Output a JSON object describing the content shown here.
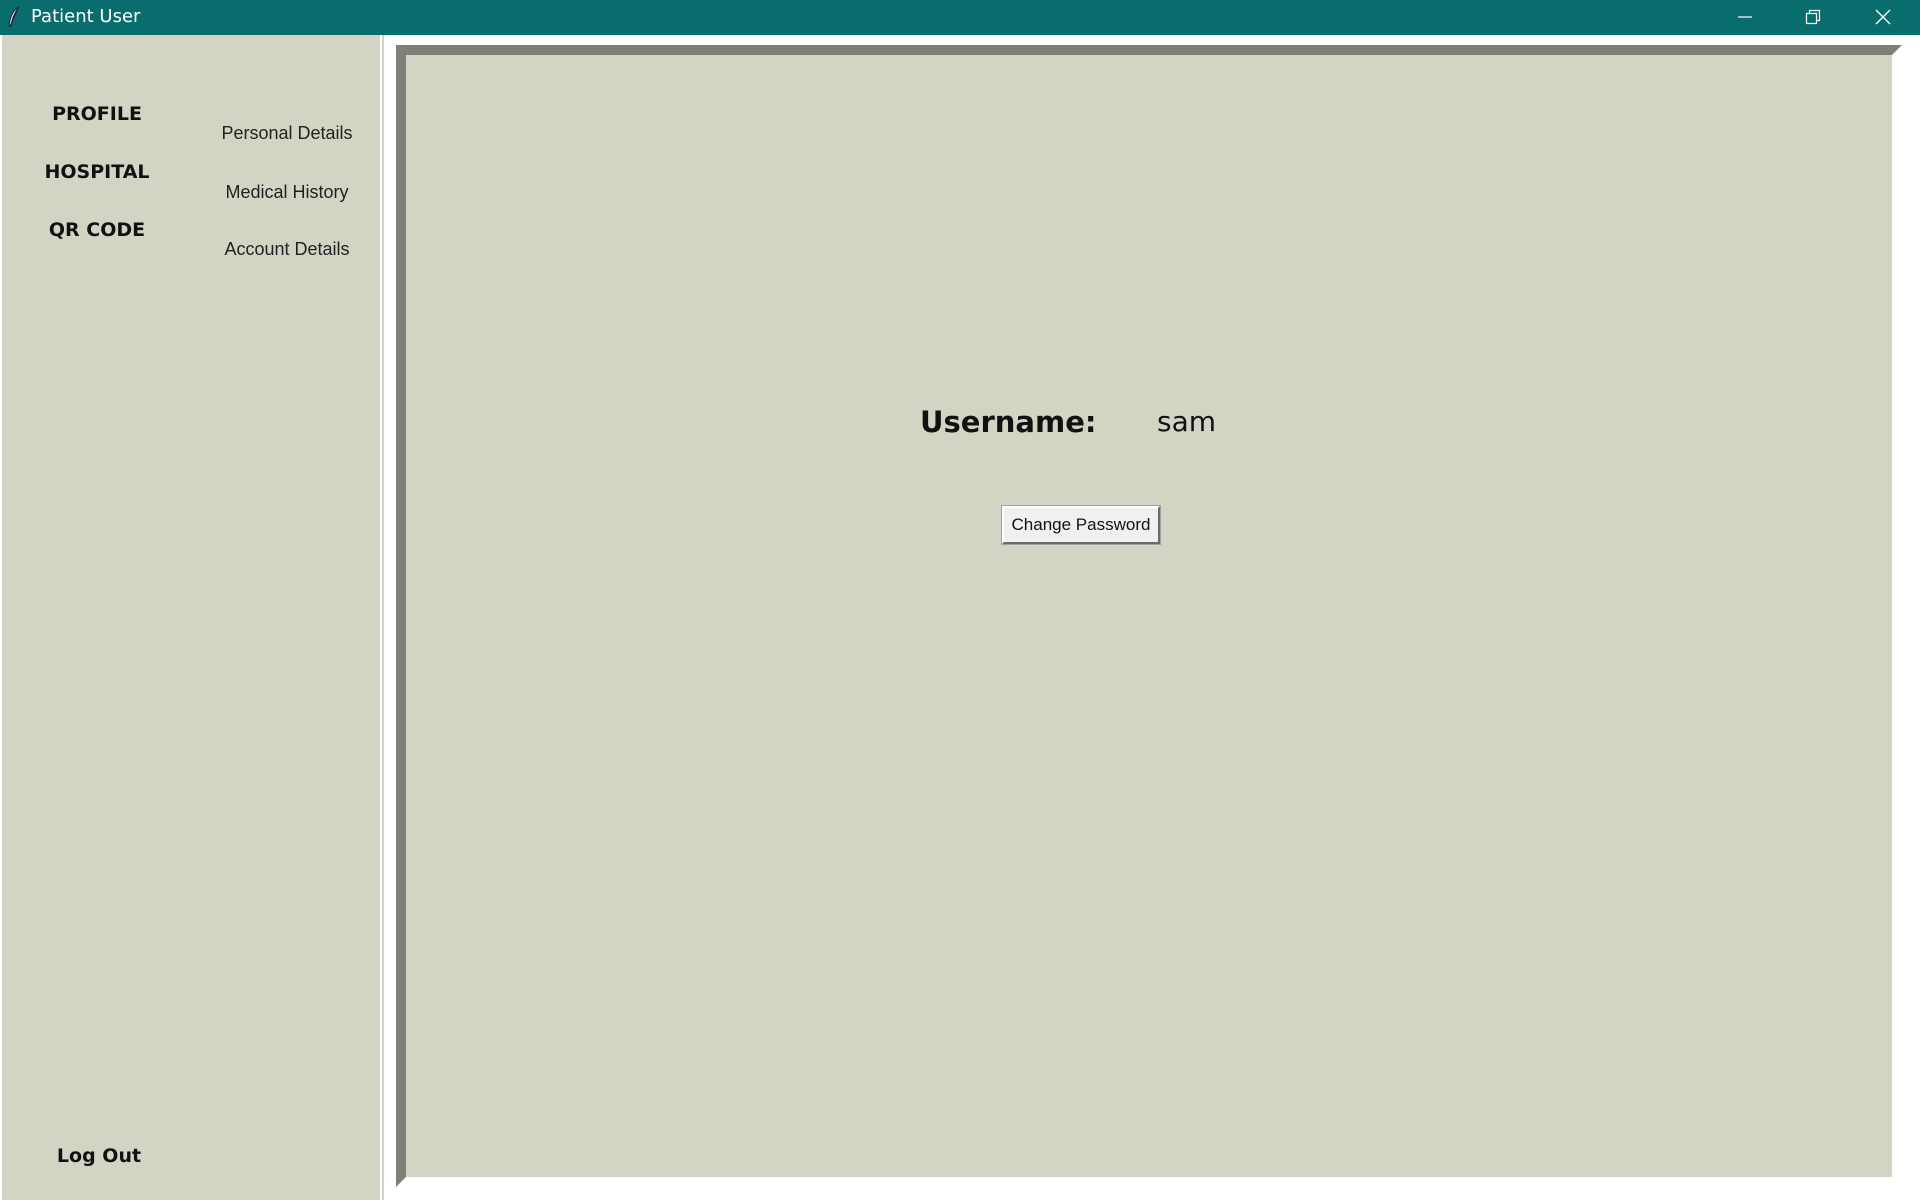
{
  "window": {
    "title": "Patient User",
    "icon": "feather-icon",
    "title_bar_color": "#096d6d",
    "controls": [
      "minimize-icon",
      "restore-icon",
      "close-icon"
    ]
  },
  "sidebar": {
    "nav_items": [
      {
        "label": "PROFILE"
      },
      {
        "label": "HOSPITAL"
      },
      {
        "label": "QR CODE"
      }
    ],
    "sub_items": [
      {
        "label": "Personal Details"
      },
      {
        "label": "Medical History"
      },
      {
        "label": "Account Details"
      }
    ],
    "logout_label": "Log Out"
  },
  "main": {
    "username_label": "Username:",
    "username_value": "sam",
    "change_password_label": "Change Password"
  },
  "colors": {
    "background": "#d4d4c4",
    "panel_border_dark": "#808078",
    "panel_border_light": "#ffffff"
  }
}
